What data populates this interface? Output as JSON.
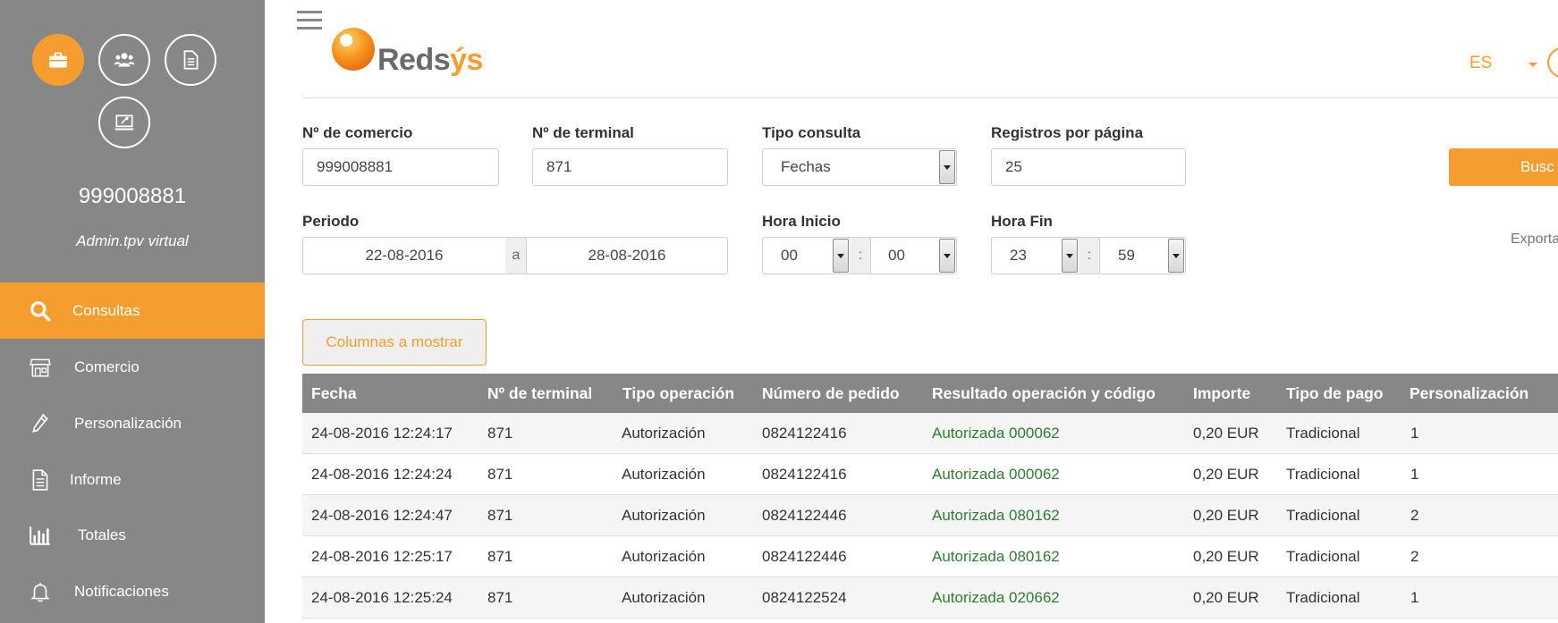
{
  "sidebar": {
    "merchant_id": "999008881",
    "user_role": "Admin.tpv virtual",
    "top_icons": [
      "briefcase-icon",
      "users-icon",
      "document-icon",
      "laptop-tools-icon"
    ],
    "nav": [
      {
        "label": "Consultas",
        "icon": "search-icon",
        "active": true
      },
      {
        "label": "Comercio",
        "icon": "store-icon",
        "active": false
      },
      {
        "label": "Personalización",
        "icon": "pencil-icon",
        "active": false
      },
      {
        "label": "Informe",
        "icon": "report-icon",
        "active": false
      },
      {
        "label": "Totales",
        "icon": "bar-chart-icon",
        "active": false
      },
      {
        "label": "Notificaciones",
        "icon": "bell-icon",
        "active": false
      }
    ]
  },
  "header": {
    "logo_text_main": "Reds",
    "logo_text_accent": "ýs",
    "language": "ES"
  },
  "form": {
    "merchant_label": "Nº de comercio",
    "merchant_value": "999008881",
    "terminal_label": "Nº de terminal",
    "terminal_value": "871",
    "query_type_label": "Tipo consulta",
    "query_type_value": "Fechas",
    "records_label": "Registros por página",
    "records_value": "25",
    "period_label": "Periodo",
    "period_from": "22-08-2016",
    "period_sep": "a",
    "period_to": "28-08-2016",
    "start_label": "Hora Inicio",
    "start_hour": "00",
    "start_min": "00",
    "end_label": "Hora Fin",
    "end_hour": "23",
    "end_min": "59",
    "time_sep": ":",
    "search_button": "Busc",
    "export_label": "Exporta"
  },
  "columns_button": "Columnas a mostrar",
  "table": {
    "headers": [
      "Fecha",
      "Nº de terminal",
      "Tipo operación",
      "Número de pedido",
      "Resultado operación y código",
      "Importe",
      "Tipo de pago",
      "Personalización"
    ],
    "rows": [
      [
        "24-08-2016 12:24:17",
        "871",
        "Autorización",
        "0824122416",
        "Autorizada 000062",
        "0,20 EUR",
        "Tradicional",
        "1"
      ],
      [
        "24-08-2016 12:24:24",
        "871",
        "Autorización",
        "0824122416",
        "Autorizada 000062",
        "0,20 EUR",
        "Tradicional",
        "1"
      ],
      [
        "24-08-2016 12:24:47",
        "871",
        "Autorización",
        "0824122446",
        "Autorizada 080162",
        "0,20 EUR",
        "Tradicional",
        "2"
      ],
      [
        "24-08-2016 12:25:17",
        "871",
        "Autorización",
        "0824122446",
        "Autorizada 080162",
        "0,20 EUR",
        "Tradicional",
        "2"
      ],
      [
        "24-08-2016 12:25:24",
        "871",
        "Autorización",
        "0824122524",
        "Autorizada 020662",
        "0,20 EUR",
        "Tradicional",
        "1"
      ]
    ]
  },
  "colors": {
    "accent": "#f59d2f",
    "sidebar": "#878787",
    "success_text": "#2e7d32"
  }
}
